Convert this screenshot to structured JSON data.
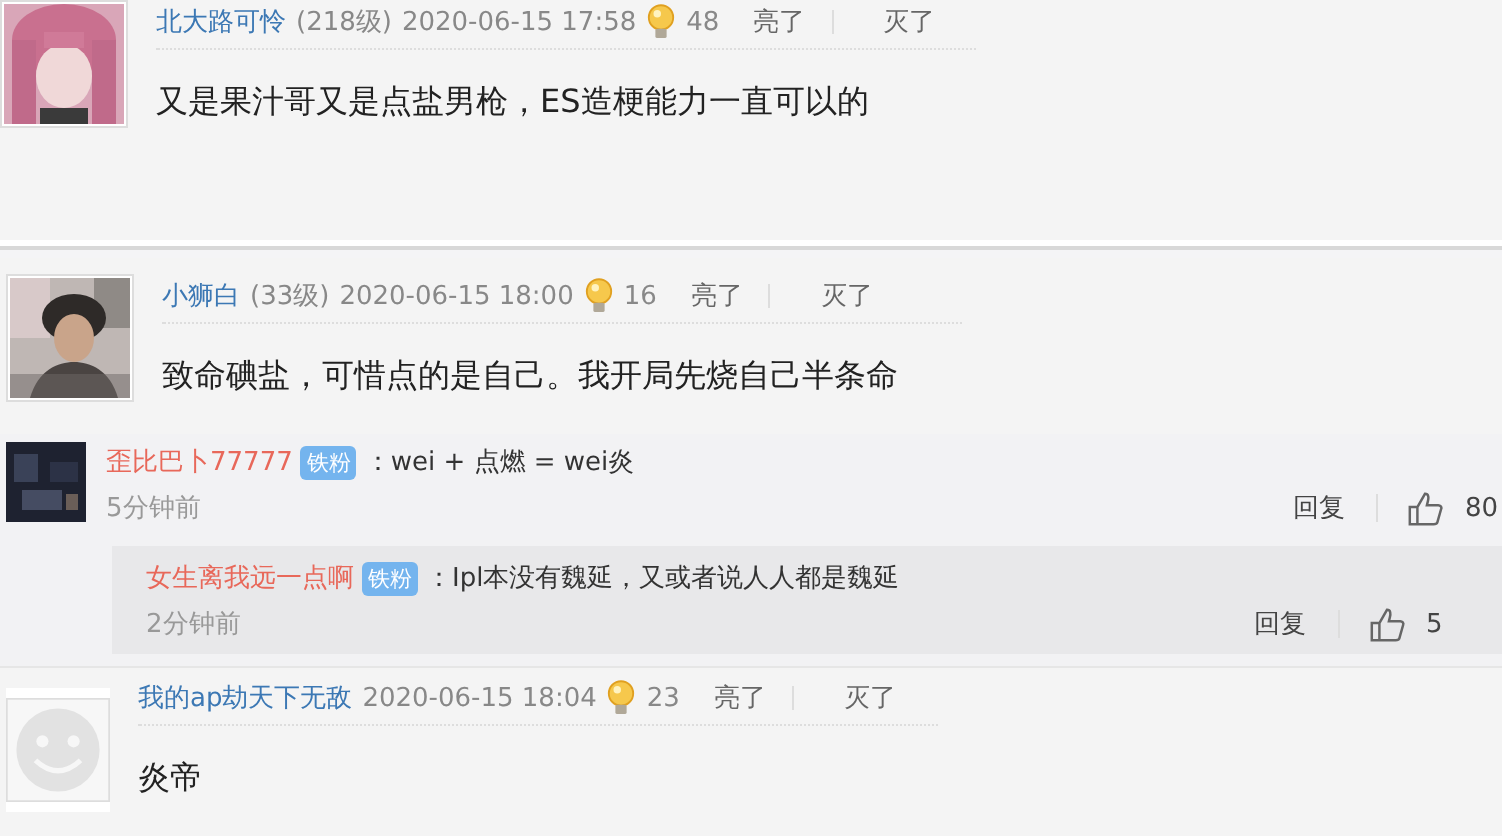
{
  "posts": [
    {
      "kind": "floor",
      "author": "北大路可怜",
      "rank": "(218级)",
      "date": "2020-06-15 17:58",
      "likes": "48",
      "up": "亮了",
      "down": "灭了",
      "text": "又是果汁哥又是点盐男枪，ES造梗能力一直可以的"
    },
    {
      "kind": "floor",
      "author": "小狮白",
      "rank": "(33级)",
      "date": "2020-06-15 18:00",
      "likes": "16",
      "up": "亮了",
      "down": "灭了",
      "text": "致命碘盐，可惜点的是自己。我开局先烧自己半条命"
    },
    {
      "kind": "reply",
      "author": "歪比巴卜77777",
      "badge": "铁粉",
      "text": "：wei + 点燃 = wei炎",
      "time": "5分钟前",
      "reply": "回复",
      "likes": "80",
      "nested": {
        "author": "女生离我远一点啊",
        "badge": "铁粉",
        "text": "：Ipl本没有魏延，又或者说人人都是魏延",
        "time": "2分钟前",
        "reply": "回复",
        "likes": "5"
      }
    },
    {
      "kind": "floor",
      "avatar": {
        "kind": "default"
      },
      "author": "我的ap劫天下无敌",
      "date": "2020-06-15 18:04",
      "likes": "23",
      "up": "亮了",
      "down": "灭了",
      "text": "炎帝"
    }
  ]
}
